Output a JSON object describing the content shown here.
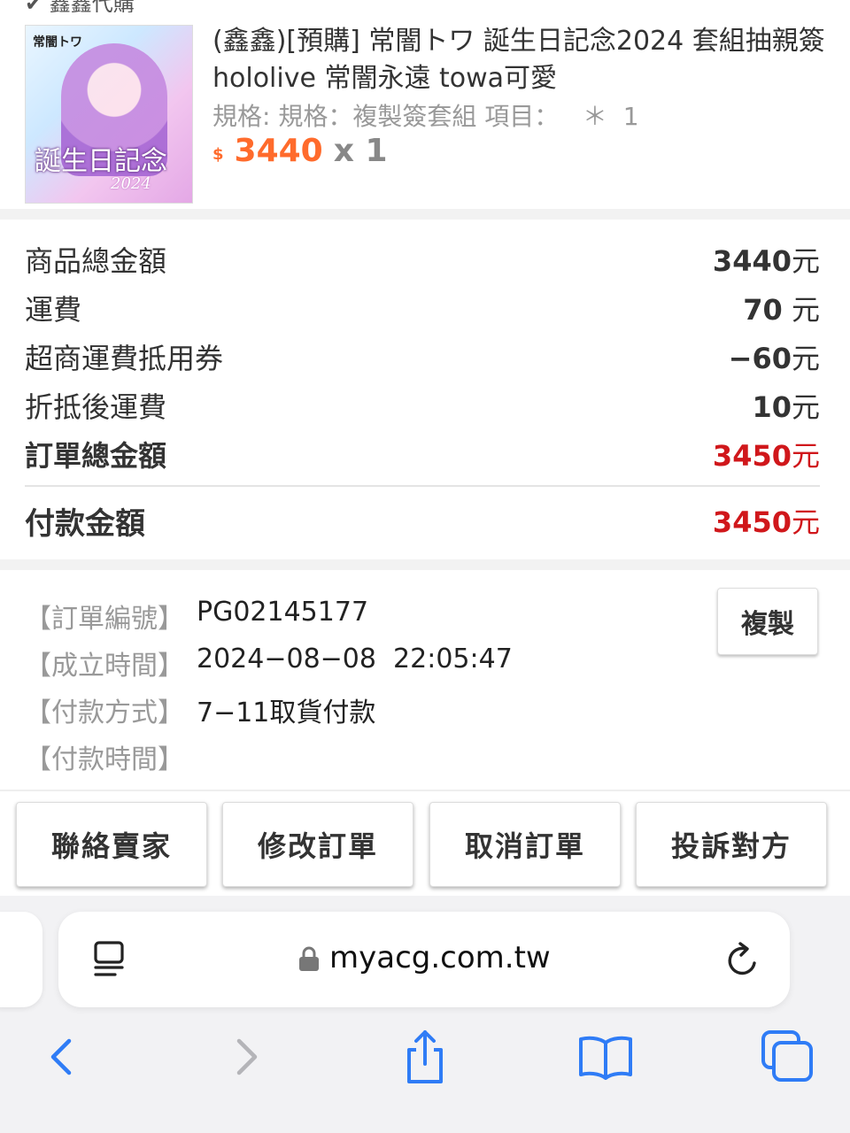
{
  "top_strip": {
    "text": "✔ 鑫鑫代購"
  },
  "product": {
    "thumb_logo": "常闇トワ",
    "thumb_caption": "誕生日記念",
    "thumb_year": "2024",
    "title": "(鑫鑫)[預購] 常闇トワ 誕生日記念2024 套組抽親簽 hololive 常闇永遠 towa可愛",
    "spec": "規格: 規格：複製簽套組 項目：   ＊  1",
    "currency": "$",
    "price": "3440",
    "qty": "x 1"
  },
  "summary": {
    "rows": [
      {
        "label": "商品總金額",
        "amount": "3440",
        "unit": "元"
      },
      {
        "label": "運費",
        "amount": "70",
        "unit": " 元"
      },
      {
        "label": "超商運費抵用券",
        "amount": "−60",
        "unit": "元"
      },
      {
        "label": "折抵後運費",
        "amount": "10",
        "unit": "元"
      },
      {
        "label": "訂單總金額",
        "amount": "3450",
        "unit": "元"
      }
    ],
    "pay": {
      "label": "付款金額",
      "amount": "3450",
      "unit": "元"
    }
  },
  "order_info": {
    "rows": [
      {
        "label": "【訂單編號】",
        "value": "PG02145177"
      },
      {
        "label": "【成立時間】",
        "value": "2024−08−08  22:05:47"
      },
      {
        "label": "【付款方式】",
        "value": "7−11取貨付款"
      },
      {
        "label": "【付款時間】",
        "value": ""
      }
    ],
    "copy_button": "複製"
  },
  "actions": [
    "聯絡賣家",
    "修改訂單",
    "取消訂單",
    "投訴對方"
  ],
  "browser": {
    "url": "myacg.com.tw",
    "icons": [
      "reader-icon",
      "lock-icon",
      "reload-icon",
      "back-icon",
      "forward-icon",
      "share-icon",
      "bookmarks-icon",
      "tabs-icon"
    ],
    "accent": "#2f7cf6",
    "disabled": "#b4b4b8"
  },
  "colors": {
    "price_orange": "#ff6b2c",
    "total_red": "#d0171b",
    "label_gray": "#999999"
  }
}
